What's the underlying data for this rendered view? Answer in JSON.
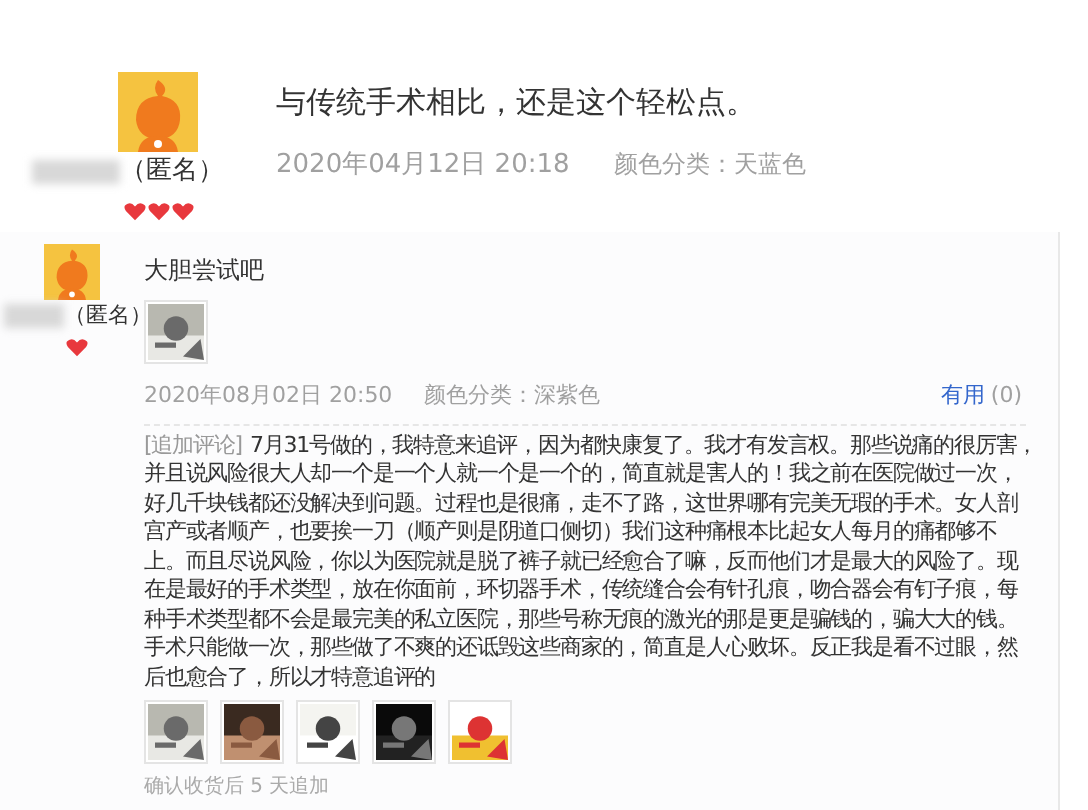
{
  "reviews": [
    {
      "kind": "large",
      "author": "（匿名）",
      "badges": [
        {
          "kind": "heart"
        },
        {
          "kind": "heart"
        },
        {
          "kind": "heart"
        }
      ],
      "comment": "与传统手术相比，还是这个轻松点。",
      "date": "2020年04月12日 20:18",
      "variant": "颜色分类：天蓝色"
    },
    {
      "kind": "small",
      "author": "（匿名）",
      "badges": [
        {
          "kind": "heart"
        }
      ],
      "comment": "大胆尝试吧",
      "photos": [
        {
          "kind": "picture"
        }
      ],
      "date": "2020年08月02日 20:50",
      "variant": "颜色分类：深紫色",
      "useful": "有用",
      "useful_count": "(0)",
      "append": {
        "label": "[追加评论]",
        "text": "7月31号做的，我特意来追评，因为都快康复了。我才有发言权。那些说痛的很厉害，并且说风险很大人却一个是一个人就一个是一个的，简直就是害人的！我之前在医院做过一次，好几千块钱都还没解决到问题。过程也是很痛，走不了路，这世界哪有完美无瑕的手术。女人剖宫产或者顺产，也要挨一刀（顺产则是阴道口侧切）我们这种痛根本比起女人每月的痛都够不上。而且尽说风险，你以为医院就是脱了裤子就已经愈合了嘛，反而他们才是最大的风险了。现在是最好的手术类型，放在你面前，环切器手术，传统缝合会有针孔痕，吻合器会有钉子痕，每种手术类型都不会是最完美的私立医院，那些号称无痕的激光的那是更是骗钱的，骗大大的钱。手术只能做一次，那些做了不爽的还诋毁这些商家的，简直是人心败坏。反正我是看不过眼，然后也愈合了，所以才特意追评的",
        "photos": [
          {
            "kind": "picture"
          },
          {
            "kind": "picture"
          },
          {
            "kind": "picture"
          },
          {
            "kind": "picture"
          },
          {
            "kind": "picture"
          }
        ],
        "note": "确认收货后 5 天追加"
      }
    }
  ]
}
